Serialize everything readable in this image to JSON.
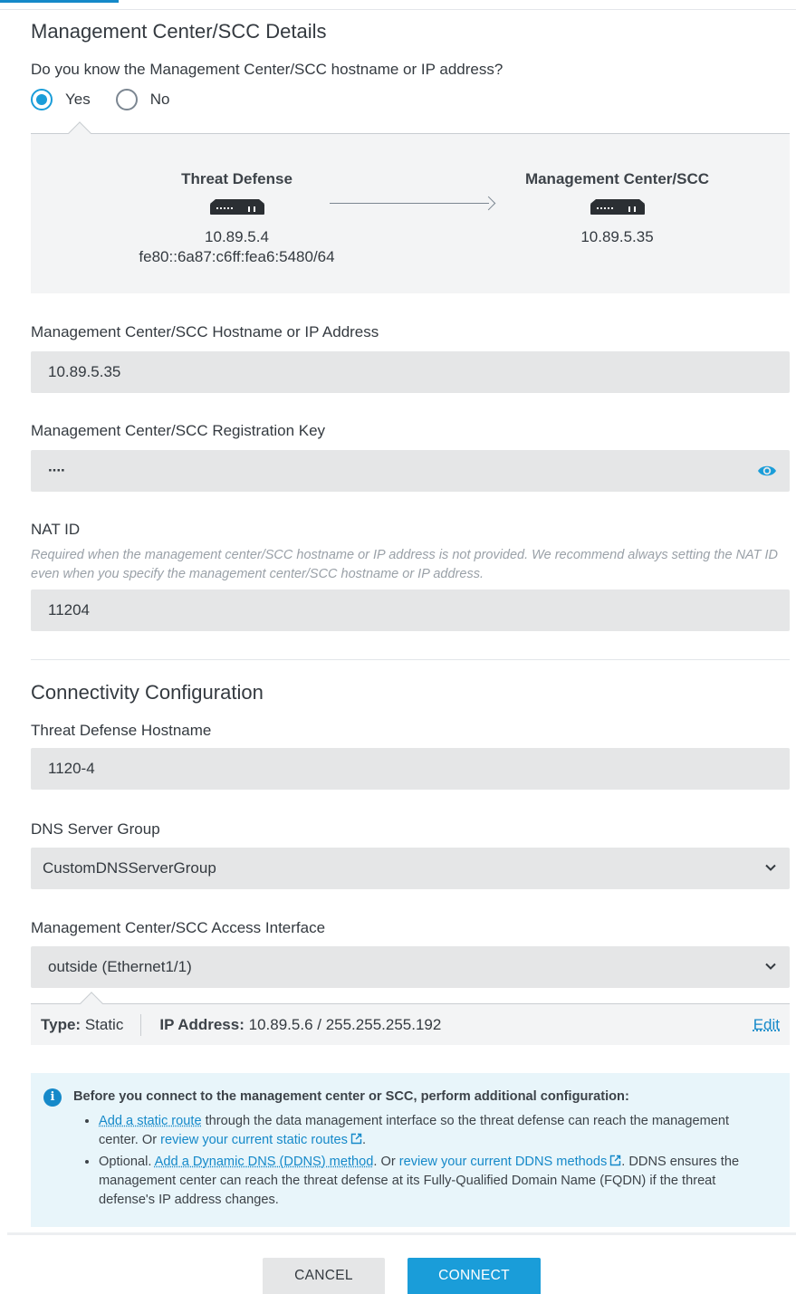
{
  "header": {
    "title": "Management Center/SCC Details",
    "question": "Do you know the Management Center/SCC hostname or IP address?",
    "options": [
      {
        "label": "Yes",
        "checked": true
      },
      {
        "label": "No",
        "checked": false
      }
    ]
  },
  "diagram": {
    "source": {
      "title": "Threat Defense",
      "ipv4": "10.89.5.4",
      "ipv6": "fe80::6a87:c6ff:fea6:5480/64",
      "icon": "network-device-icon"
    },
    "target": {
      "title": "Management Center/SCC",
      "ipv4": "10.89.5.35",
      "icon": "network-device-icon"
    }
  },
  "fields": {
    "hostname": {
      "label": "Management Center/SCC Hostname or IP Address",
      "value": "10.89.5.35"
    },
    "regkey": {
      "label": "Management Center/SCC Registration Key",
      "value": "····",
      "icon": "eye-icon"
    },
    "natid": {
      "label": "NAT ID",
      "help": "Required when the management center/SCC hostname or IP address is not provided. We recommend always setting the NAT ID even when you specify the management center/SCC hostname or IP address.",
      "value": "11204"
    }
  },
  "connectivity": {
    "title": "Connectivity Configuration",
    "hostname": {
      "label": "Threat Defense Hostname",
      "value": "1120-4"
    },
    "dns": {
      "label": "DNS Server Group",
      "value": "CustomDNSServerGroup"
    },
    "iface": {
      "label": "Management Center/SCC Access Interface",
      "value": "outside (Ethernet1/1)"
    },
    "iface_detail": {
      "type_label": "Type:",
      "type_value": "Static",
      "ip_label": "IP Address:",
      "ip_value": "10.89.5.6 / 255.255.255.192",
      "edit": "Edit"
    }
  },
  "info": {
    "heading": "Before you connect to the management center or SCC, perform additional configuration:",
    "item1": {
      "link1": "Add a static route",
      "text1": " through the data management interface so the threat defense can reach the management center. Or ",
      "link2": "review your current static routes",
      "text2": "."
    },
    "item2": {
      "text0": "Optional. ",
      "link1": "Add a Dynamic DNS (DDNS) method",
      "text1": ". Or ",
      "link2": "review your current DDNS methods",
      "text2": ". DDNS ensures the management center can reach the threat defense at its Fully-Qualified Domain Name (FQDN) if the threat defense's IP address changes."
    }
  },
  "buttons": {
    "cancel": "CANCEL",
    "connect": "CONNECT"
  },
  "colors": {
    "accent": "#1a9dd9",
    "link": "#1589c9",
    "field_bg": "#e5e6e7",
    "info_bg": "#e8f5fa"
  }
}
